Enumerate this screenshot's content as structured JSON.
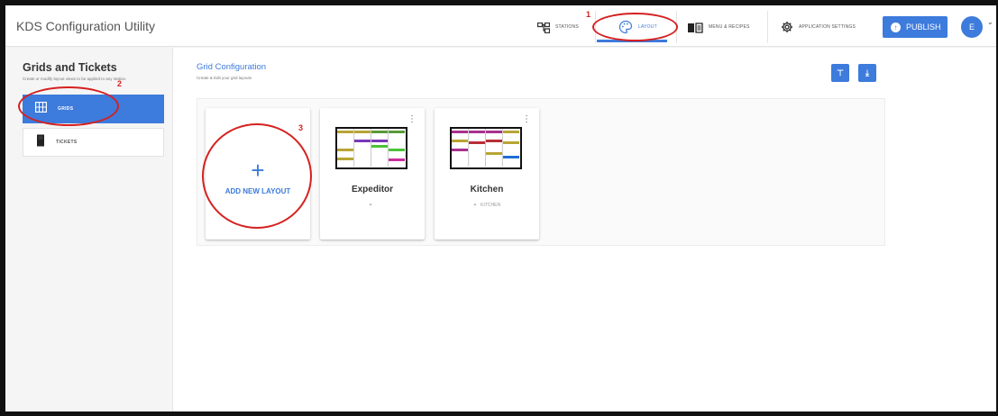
{
  "header": {
    "app_title": "KDS Configuration Utility",
    "nav": [
      {
        "label": "STATIONS",
        "icon": "stations-icon"
      },
      {
        "label": "LAYOUT",
        "icon": "palette-icon"
      },
      {
        "label": "MENU & RECIPES",
        "icon": "menu-book-icon"
      },
      {
        "label": "APPLICATION SETTINGS",
        "icon": "gear-icon"
      }
    ],
    "publish_label": "PUBLISH",
    "avatar_initial": "E"
  },
  "sidebar": {
    "title": "Grids and Tickets",
    "subtitle": "Create or modify layout views to be applied to any station.",
    "items": [
      {
        "label": "GRIDS",
        "icon": "grid-icon",
        "active": true
      },
      {
        "label": "TICKETS",
        "icon": "ticket-icon",
        "active": false
      }
    ]
  },
  "main": {
    "title": "Grid Configuration",
    "subtitle": "Create & Edit your grid layouts",
    "add_plus": "+",
    "add_label": "ADD NEW LAYOUT",
    "cards": [
      {
        "name": "Expeditor",
        "station": ""
      },
      {
        "name": "Kitchen",
        "station": "KITCHEN"
      }
    ]
  },
  "annotations": {
    "step1": "1",
    "step2": "2",
    "step3": "3"
  },
  "colors": {
    "accent": "#3d7bdc",
    "annotation": "#d62020"
  }
}
